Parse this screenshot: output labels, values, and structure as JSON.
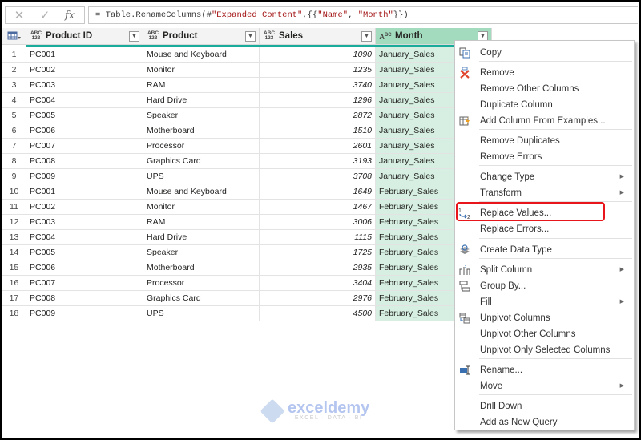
{
  "formula_bar": {
    "cancel_icon": "✕",
    "confirm_icon": "✓",
    "fx_label": "fx",
    "formula_prefix": "= Table.RenameColumns(#",
    "formula_str1": "\"Expanded Content\"",
    "formula_mid": ",{{",
    "formula_str2": "\"Name\"",
    "formula_sep": ", ",
    "formula_str3": "\"Month\"",
    "formula_suffix": "}})"
  },
  "table": {
    "columns": [
      {
        "name": "Product ID",
        "type_top": "ABC",
        "type_bottom": "123"
      },
      {
        "name": "Product",
        "type_top": "ABC",
        "type_bottom": "123"
      },
      {
        "name": "Sales",
        "type_top": "ABC",
        "type_bottom": "123"
      },
      {
        "name": "Month",
        "type_top": "A",
        "type_bottom": "BC"
      }
    ],
    "rows": [
      {
        "n": "1",
        "id": "PC001",
        "product": "Mouse and Keyboard",
        "sales": "1090",
        "month": "January_Sales"
      },
      {
        "n": "2",
        "id": "PC002",
        "product": "Monitor",
        "sales": "1235",
        "month": "January_Sales"
      },
      {
        "n": "3",
        "id": "PC003",
        "product": "RAM",
        "sales": "3740",
        "month": "January_Sales"
      },
      {
        "n": "4",
        "id": "PC004",
        "product": "Hard Drive",
        "sales": "1296",
        "month": "January_Sales"
      },
      {
        "n": "5",
        "id": "PC005",
        "product": "Speaker",
        "sales": "2872",
        "month": "January_Sales"
      },
      {
        "n": "6",
        "id": "PC006",
        "product": "Motherboard",
        "sales": "1510",
        "month": "January_Sales"
      },
      {
        "n": "7",
        "id": "PC007",
        "product": "Processor",
        "sales": "2601",
        "month": "January_Sales"
      },
      {
        "n": "8",
        "id": "PC008",
        "product": "Graphics Card",
        "sales": "3193",
        "month": "January_Sales"
      },
      {
        "n": "9",
        "id": "PC009",
        "product": "UPS",
        "sales": "3708",
        "month": "January_Sales"
      },
      {
        "n": "10",
        "id": "PC001",
        "product": "Mouse and Keyboard",
        "sales": "1649",
        "month": "February_Sales"
      },
      {
        "n": "11",
        "id": "PC002",
        "product": "Monitor",
        "sales": "1467",
        "month": "February_Sales"
      },
      {
        "n": "12",
        "id": "PC003",
        "product": "RAM",
        "sales": "3006",
        "month": "February_Sales"
      },
      {
        "n": "13",
        "id": "PC004",
        "product": "Hard Drive",
        "sales": "1115",
        "month": "February_Sales"
      },
      {
        "n": "14",
        "id": "PC005",
        "product": "Speaker",
        "sales": "1725",
        "month": "February_Sales"
      },
      {
        "n": "15",
        "id": "PC006",
        "product": "Motherboard",
        "sales": "2935",
        "month": "February_Sales"
      },
      {
        "n": "16",
        "id": "PC007",
        "product": "Processor",
        "sales": "3404",
        "month": "February_Sales"
      },
      {
        "n": "17",
        "id": "PC008",
        "product": "Graphics Card",
        "sales": "2976",
        "month": "February_Sales"
      },
      {
        "n": "18",
        "id": "PC009",
        "product": "UPS",
        "sales": "4500",
        "month": "February_Sales"
      }
    ]
  },
  "context_menu": {
    "items": [
      {
        "label": "Copy",
        "icon": "copy-icon"
      },
      {
        "label": "Remove",
        "icon": "remove-column-icon"
      },
      {
        "label": "Remove Other Columns"
      },
      {
        "label": "Duplicate Column"
      },
      {
        "label": "Add Column From Examples...",
        "icon": "column-from-examples-icon"
      },
      {
        "label": "Remove Duplicates"
      },
      {
        "label": "Remove Errors"
      },
      {
        "label": "Change Type",
        "submenu": true
      },
      {
        "label": "Transform",
        "submenu": true
      },
      {
        "label": "Replace Values...",
        "icon": "replace-values-icon",
        "highlighted": true
      },
      {
        "label": "Replace Errors..."
      },
      {
        "label": "Create Data Type",
        "icon": "data-type-icon"
      },
      {
        "label": "Split Column",
        "icon": "split-column-icon",
        "submenu": true
      },
      {
        "label": "Group By...",
        "icon": "group-by-icon"
      },
      {
        "label": "Fill",
        "submenu": true
      },
      {
        "label": "Unpivot Columns",
        "icon": "unpivot-icon"
      },
      {
        "label": "Unpivot Other Columns"
      },
      {
        "label": "Unpivot Only Selected Columns"
      },
      {
        "label": "Rename...",
        "icon": "rename-icon"
      },
      {
        "label": "Move",
        "submenu": true
      },
      {
        "label": "Drill Down"
      },
      {
        "label": "Add as New Query"
      }
    ]
  },
  "watermark": {
    "brand": "exceldemy",
    "tagline": "EXCEL · DATA · BI"
  },
  "colors": {
    "accent_teal": "#1aab9b",
    "selected_header": "#a3dbbf",
    "selected_column": "#d6efe2",
    "highlight_box": "#e8161a"
  }
}
